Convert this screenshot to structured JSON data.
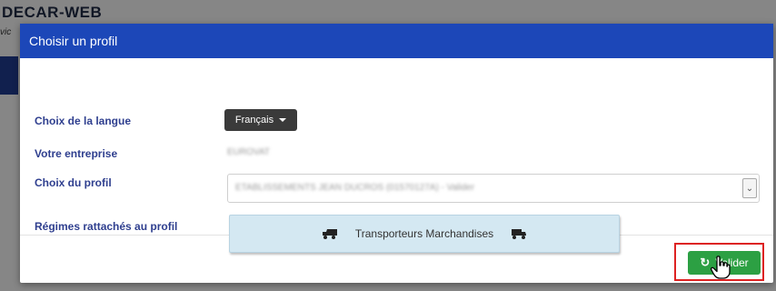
{
  "background": {
    "app_title": "DECAR-WEB",
    "app_subtitle": "vic"
  },
  "modal": {
    "title": "Choisir un profil",
    "fields": {
      "language_label": "Choix de la langue",
      "language_value": "Français",
      "company_label": "Votre entreprise",
      "company_value": "EUROVAT",
      "profile_label": "Choix du profil",
      "profile_value": "ETABLISSEMENTS JEAN DUCROS (01570127A) - Valider",
      "regimes_label": "Régimes rattachés au profil",
      "regime_item": "Transporteurs Marchandises"
    },
    "footer": {
      "validate_label": "Valider"
    }
  },
  "colors": {
    "header_bg": "#1c47b8",
    "label_text": "#2f3f8f",
    "validate_bg": "#2ca043",
    "highlight": "#dd2222",
    "regime_bg": "#d4e8f2"
  },
  "icons": [
    "truck-icon",
    "truck-icon",
    "refresh-icon",
    "hand-cursor-icon",
    "chevron-down-icon",
    "caret-down-icon"
  ]
}
